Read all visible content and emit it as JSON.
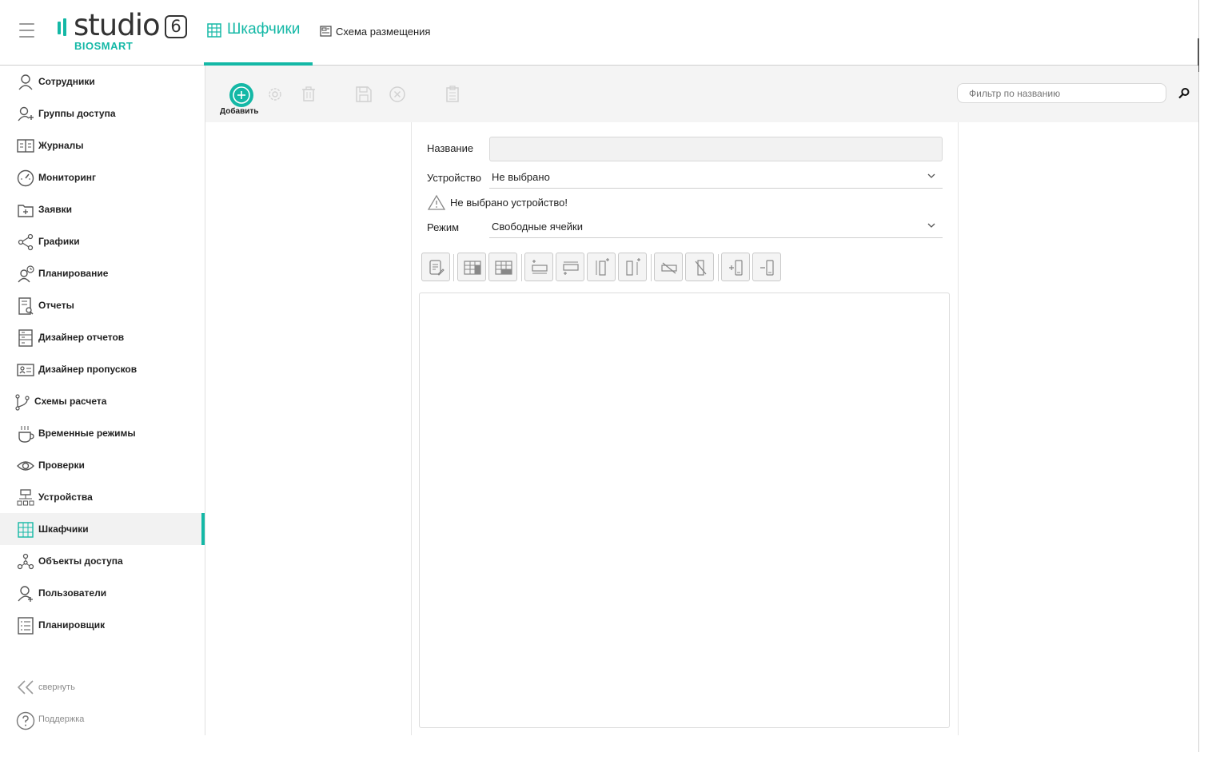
{
  "header": {
    "logo_word": "studio",
    "logo_version": "6",
    "logo_sub": "BIOSMART",
    "active_tab": "Шкафчики",
    "second_tab": "Схема размещения"
  },
  "sidebar": {
    "items": [
      {
        "label": "Сотрудники",
        "icon": "user-icon"
      },
      {
        "label": "Группы доступа",
        "icon": "user-group-icon"
      },
      {
        "label": "Журналы",
        "icon": "book-icon"
      },
      {
        "label": "Мониторинг",
        "icon": "gauge-icon"
      },
      {
        "label": "Заявки",
        "icon": "folder-plus-icon"
      },
      {
        "label": "Графики",
        "icon": "share-icon"
      },
      {
        "label": "Планирование",
        "icon": "user-clock-icon"
      },
      {
        "label": "Отчеты",
        "icon": "report-search-icon"
      },
      {
        "label": "Дизайнер отчетов",
        "icon": "report-design-icon"
      },
      {
        "label": "Дизайнер пропусков",
        "icon": "id-card-icon"
      },
      {
        "label": "Схемы расчета",
        "icon": "branch-icon"
      },
      {
        "label": "Временные режимы",
        "icon": "cup-icon"
      },
      {
        "label": "Проверки",
        "icon": "eye-icon"
      },
      {
        "label": "Устройства",
        "icon": "network-icon"
      },
      {
        "label": "Шкафчики",
        "icon": "locker-icon"
      },
      {
        "label": "Объекты доступа",
        "icon": "nodes-icon"
      },
      {
        "label": "Пользователи",
        "icon": "user-plus-icon"
      },
      {
        "label": "Планировщик",
        "icon": "list-icon"
      }
    ],
    "active_index": 14,
    "collapse_label": "свернуть",
    "support_label": "Поддержка"
  },
  "toolbar": {
    "add_label": "Добавить",
    "filter_placeholder": "Фильтр по названию"
  },
  "form": {
    "name_label": "Название",
    "name_value": "",
    "device_label": "Устройство",
    "device_value": "Не выбрано",
    "warning_text": "Не выбрано устройство!",
    "mode_label": "Режим",
    "mode_value": "Свободные ячейки"
  },
  "colors": {
    "accent": "#14b8a6",
    "icon_gray": "#555555",
    "disabled_gray": "#cfcfcf"
  }
}
